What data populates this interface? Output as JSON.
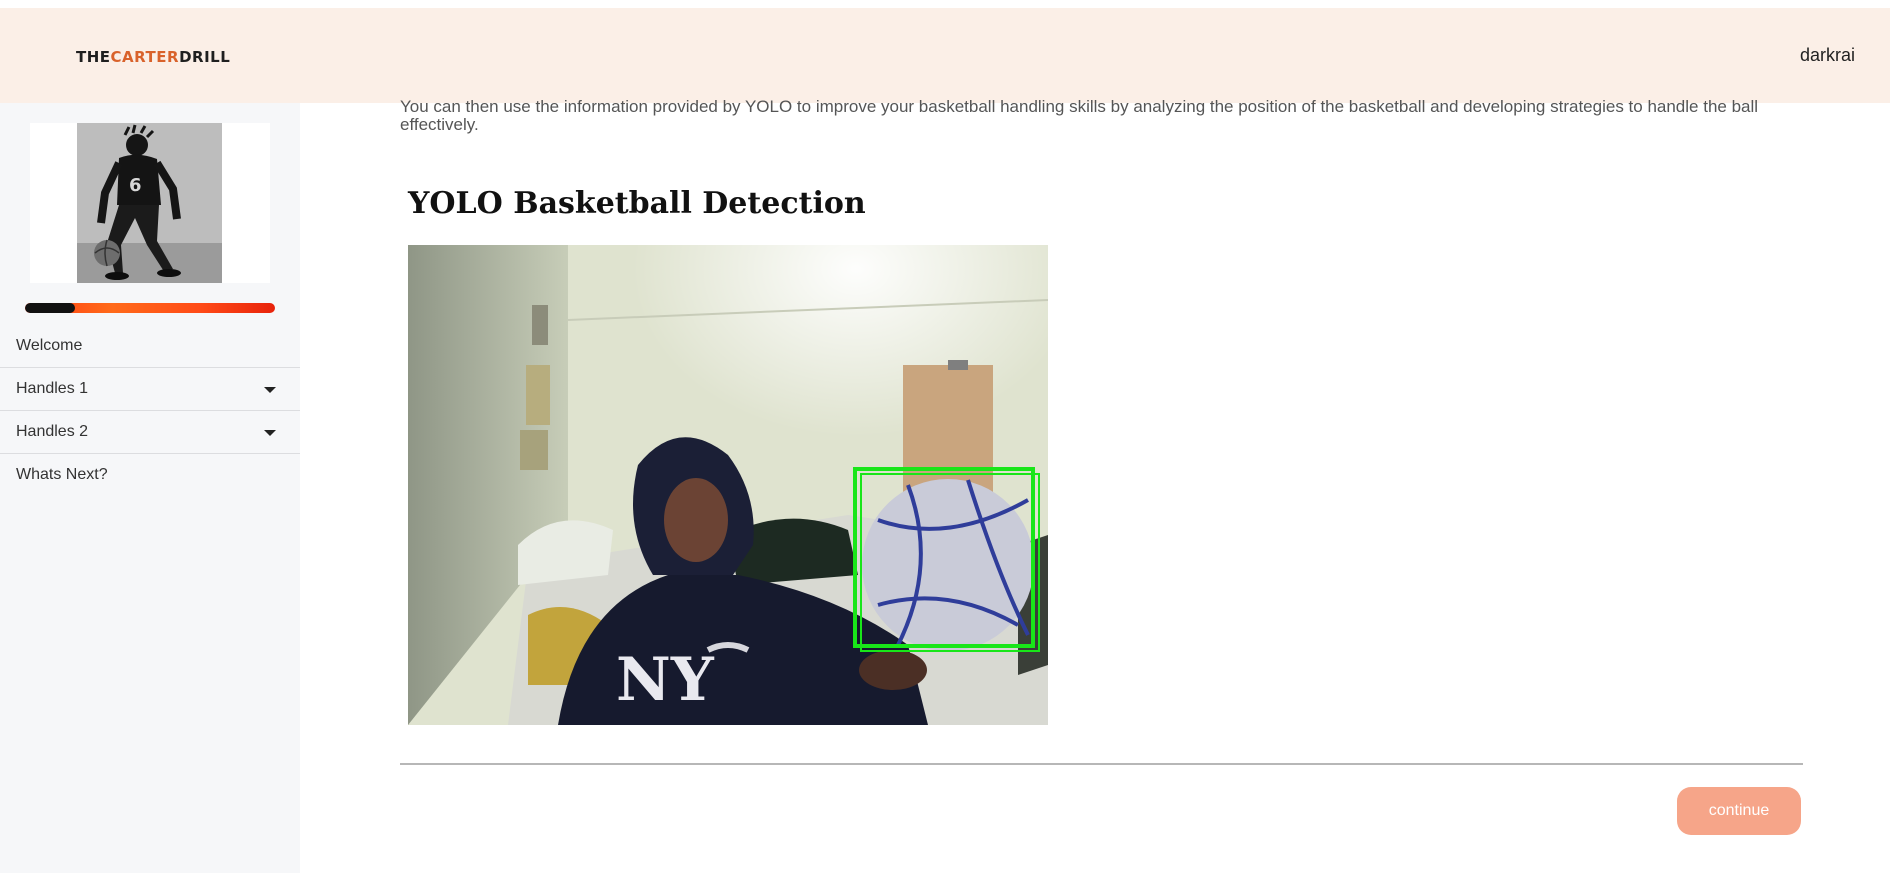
{
  "header": {
    "brand_part1": "THE",
    "brand_part2": "CARTER",
    "brand_part3": "DRILL",
    "username": "darkrai",
    "accent_color": "#d9622b",
    "background_color": "#fbefe7"
  },
  "sidebar": {
    "progress_fraction": 0.2,
    "items": [
      {
        "label": "Welcome",
        "has_dropdown": false
      },
      {
        "label": "Handles 1",
        "has_dropdown": true
      },
      {
        "label": "Handles 2",
        "has_dropdown": true
      },
      {
        "label": "Whats Next?",
        "has_dropdown": false
      }
    ]
  },
  "main": {
    "intro_text": "You can then use the information provided by YOLO to improve your basketball handling skills by analyzing the position of the basketball and developing strategies to handle the ball effectively.",
    "section_title": "YOLO Basketball Detection",
    "detection_box_color": "#19e619",
    "continue_label": "continue"
  }
}
